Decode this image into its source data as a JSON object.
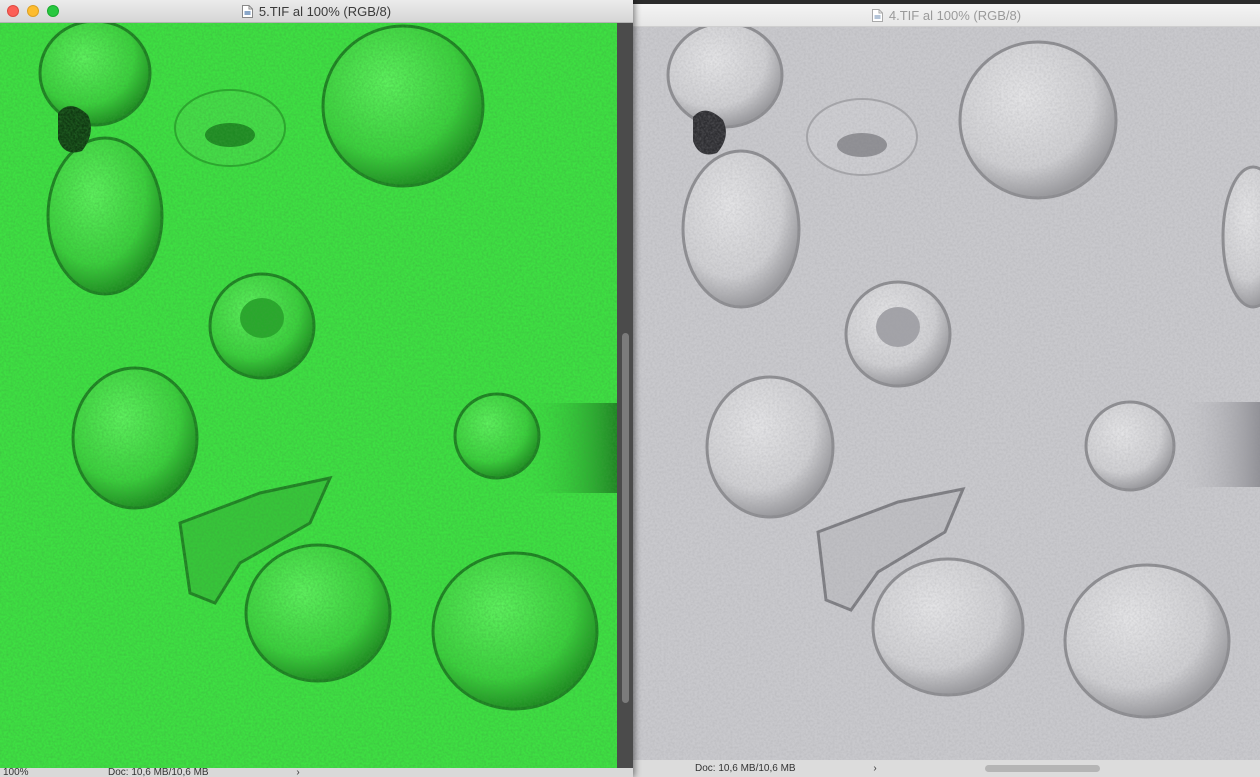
{
  "left_window": {
    "title": "5.TIF al 100% (RGB/8)",
    "zoom": "100%",
    "doc_info": "Doc: 10,6 MB/10,6 MB",
    "arrow": "›",
    "image_tint": "#3ee043"
  },
  "right_window": {
    "title": "4.TIF al 100% (RGB/8)",
    "doc_info": "Doc: 10,6 MB/10,6 MB",
    "arrow": "›",
    "image_tint": "#c9c9cd"
  },
  "icons": {
    "document": "document-icon",
    "close": "close-icon",
    "minimize": "minimize-icon",
    "zoom": "zoom-icon"
  }
}
